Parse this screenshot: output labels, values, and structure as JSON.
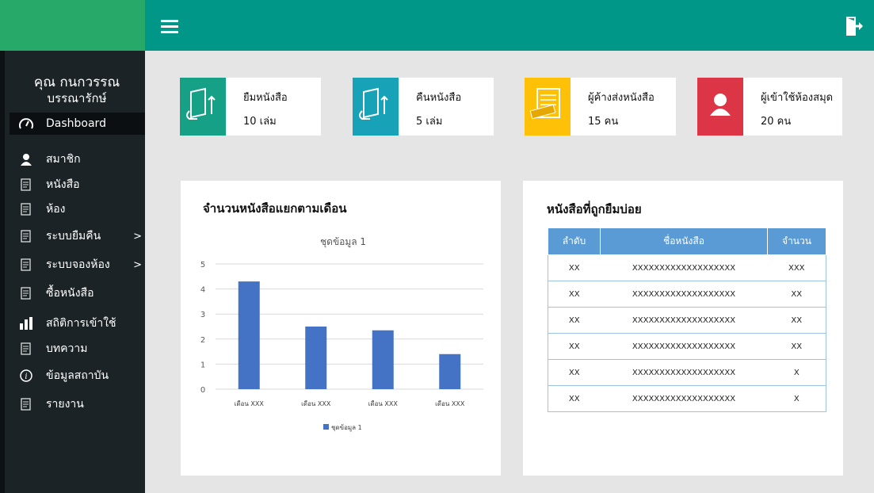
{
  "user": {
    "name": "คุณ กนกวรรณ",
    "role": "บรรณารักษ์"
  },
  "nav": {
    "items": [
      {
        "label": "Dashboard",
        "icon": "gauge-icon",
        "active": true
      },
      {
        "label": "สมาชิก",
        "icon": "user-icon"
      },
      {
        "label": "หนังสือ",
        "icon": "books-icon"
      },
      {
        "label": "ห้อง",
        "icon": "room-icon"
      },
      {
        "label": "ระบบยืมคืน",
        "icon": "borrow-icon",
        "arrow": ">"
      },
      {
        "label": "ระบบจองห้อง",
        "icon": "reserve-icon",
        "arrow": ">"
      },
      {
        "label": "ซื้อหนังสือ",
        "icon": "purchase-icon"
      },
      {
        "label": "สถิติการเข้าใช้",
        "icon": "bar-chart-icon"
      },
      {
        "label": "บทความ",
        "icon": "article-icon"
      },
      {
        "label": "ข้อมูลสถาบัน",
        "icon": "info-icon"
      },
      {
        "label": "รายงาน",
        "icon": "report-icon"
      }
    ]
  },
  "cards": [
    {
      "title": "ยืมหนังสือ",
      "value": "10  เล่ม",
      "color": "#16a085",
      "icon": "book-borrow-icon"
    },
    {
      "title": "คืนหนังสือ",
      "value": "5  เล่ม",
      "color": "#17a2b8",
      "icon": "book-return-icon"
    },
    {
      "title": "ผู้ค้างส่งหนังสือ",
      "value": "15  คน",
      "color": "#ffc107",
      "icon": "overdue-icon"
    },
    {
      "title": "ผู้เข้าใช้ห้องสมุด",
      "value": "20  คน",
      "color": "#dc3545",
      "icon": "user-icon"
    }
  ],
  "chart_panel": {
    "title": "จำนวนหนังสือแยกตามเดือน"
  },
  "chart_data": {
    "type": "bar",
    "title": "ชุดข้อมูล 1",
    "categories": [
      "เดือน XXX",
      "เดือน XXX",
      "เดือน XXX",
      "เดือน XXX"
    ],
    "series": [
      {
        "name": "ชุดข้อมูล 1",
        "values": [
          4.3,
          2.5,
          2.35,
          1.4
        ]
      }
    ],
    "ylim": [
      0,
      5
    ],
    "yticks": [
      "0",
      "1",
      "2",
      "3",
      "4",
      "5"
    ],
    "grid": true,
    "legend": "bottom",
    "color": "#4472c4"
  },
  "table_panel": {
    "title": "หนังสือที่ถูกยืมบ่อย",
    "headers": [
      "ลำดับ",
      "ชื่อหนังสือ",
      "จำนวน"
    ],
    "rows": [
      [
        "XX",
        "XXXXXXXXXXXXXXXXXXX",
        "XXX"
      ],
      [
        "XX",
        "XXXXXXXXXXXXXXXXXXX",
        "XX"
      ],
      [
        "XX",
        "XXXXXXXXXXXXXXXXXXX",
        "XX"
      ],
      [
        "XX",
        "XXXXXXXXXXXXXXXXXXX",
        "XX"
      ],
      [
        "XX",
        "XXXXXXXXXXXXXXXXXXX",
        "X"
      ],
      [
        "XX",
        "XXXXXXXXXXXXXXXXXXX",
        "X"
      ]
    ]
  }
}
